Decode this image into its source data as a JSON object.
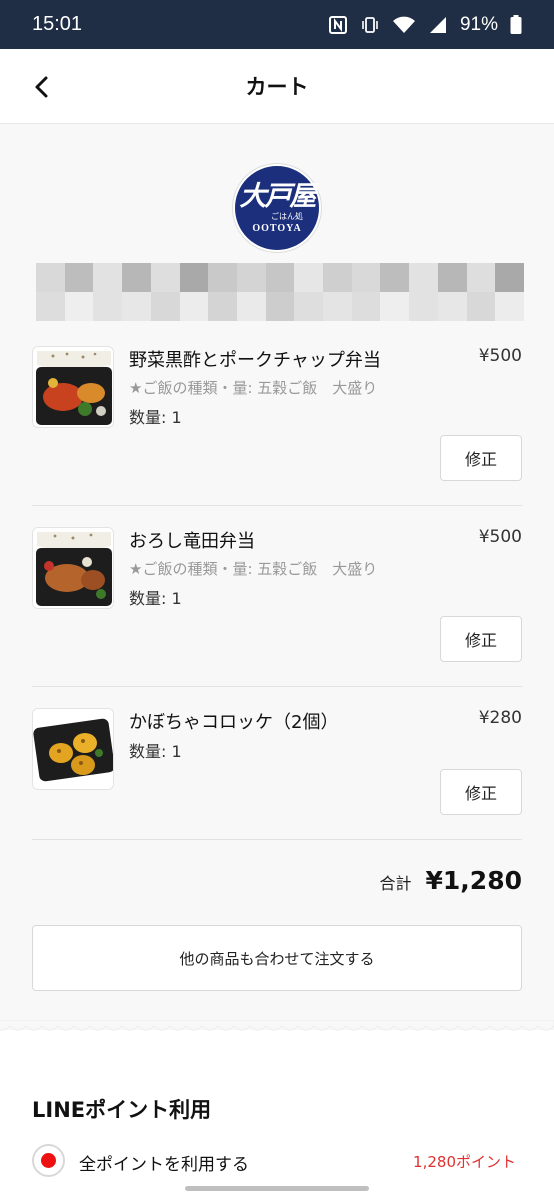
{
  "status_bar": {
    "time": "15:01",
    "battery": "91%",
    "icons": [
      "nfc-icon",
      "vibrate-icon",
      "wifi-icon",
      "signal-icon",
      "battery-icon"
    ]
  },
  "header": {
    "title": "カート",
    "back_icon": "chevron-left-icon"
  },
  "shop": {
    "logo": {
      "kanji": "大戸屋",
      "sub": "ごはん処",
      "en": "OOTOYA"
    }
  },
  "items": [
    {
      "name": "野菜黒酢とポークチャップ弁当",
      "price": "¥500",
      "option": "★ご飯の種類・量: 五穀ご飯　大盛り",
      "qty": "数量: 1",
      "edit_label": "修正"
    },
    {
      "name": "おろし竜田弁当",
      "price": "¥500",
      "option": "★ご飯の種類・量: 五穀ご飯　大盛り",
      "qty": "数量: 1",
      "edit_label": "修正"
    },
    {
      "name": "かぼちゃコロッケ（2個）",
      "price": "¥280",
      "qty": "数量: 1",
      "edit_label": "修正"
    }
  ],
  "total": {
    "label": "合計",
    "value": "¥1,280"
  },
  "more_button": "他の商品も合わせて注文する",
  "points": {
    "title": "LINEポイント利用",
    "option_label": "全ポイントを利用する",
    "value": "1,280ポイント",
    "selected": true
  },
  "colors": {
    "status_bar": "#1f2e44",
    "accent_red": "#e03131",
    "logo_blue": "#1b2f7c",
    "cart_bg": "#f8f8f8"
  }
}
